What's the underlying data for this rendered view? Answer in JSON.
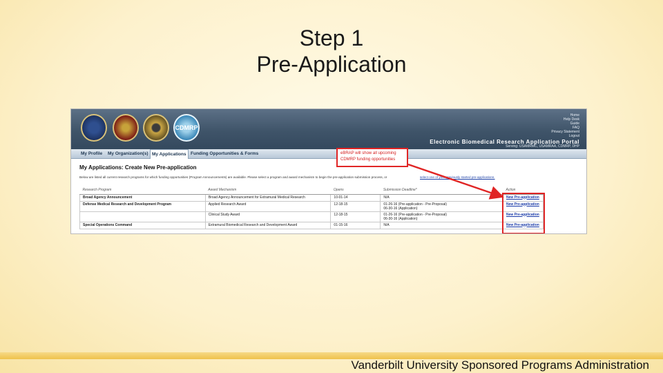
{
  "slide": {
    "title_line1": "Step 1",
    "title_line2": "Pre-Application",
    "footer": "Vanderbilt University Sponsored Programs Administration"
  },
  "portal": {
    "logo_text": "CDMRP",
    "top_links": [
      "Home",
      "Help Desk",
      "Guide",
      "FAQ",
      "Privacy Statement",
      "Logout"
    ],
    "title": "Electronic Biomedical Research Application Portal",
    "serving": "Serving: USAMRMC, USAMRAA, CDMRP, DHP",
    "nav": [
      "My Profile",
      "My Organization(s)",
      "My Applications",
      "Funding Opportunities & Forms"
    ],
    "heading": "My Applications: Create New Pre-application",
    "intro": "Below are listed all current research programs for which funding opportunities (Program Announcements) are available. Please select a program and award mechanism to begin the pre-application submission process, or",
    "intro_link": "select one of your previously started pre-applications.",
    "columns": [
      "Research Program",
      "Award Mechanism",
      "Opens",
      "Submission Deadline*",
      "Action"
    ],
    "rows": [
      {
        "program": "Broad Agency Announcement",
        "mechanism": "Broad Agency Announcement for Extramural Medical Research",
        "opens": "10-01-14",
        "deadline": "N/A",
        "action": "New Pre-application"
      },
      {
        "program": "Defense Medical Research and Development Program",
        "mechanism": "Applied Research Award",
        "opens": "12-18-15",
        "deadline": "01-26-16 (Pre-application - Pre-Proposal)",
        "deadline2": "06-30-16 (Application)",
        "action": "New Pre-application"
      },
      {
        "program": "",
        "mechanism": "Clinical Study Award",
        "opens": "12-18-15",
        "deadline": "01-26-16 (Pre-application - Pre-Proposal)",
        "deadline2": "06-30-16 (Application)",
        "action": "New Pre-application"
      },
      {
        "program": "Special Operations Command",
        "mechanism": "Extramural Biomedical Research and Development Award",
        "opens": "01-15-16",
        "deadline": "N/A",
        "action": "New Pre-application"
      }
    ],
    "callout_line1": "eBRAP will show all upcoming",
    "callout_line2": "CDMRP funding opportunities"
  },
  "colors": {
    "accent_red": "#e02525",
    "banner": "#3f5469",
    "link": "#1a3aa8"
  }
}
